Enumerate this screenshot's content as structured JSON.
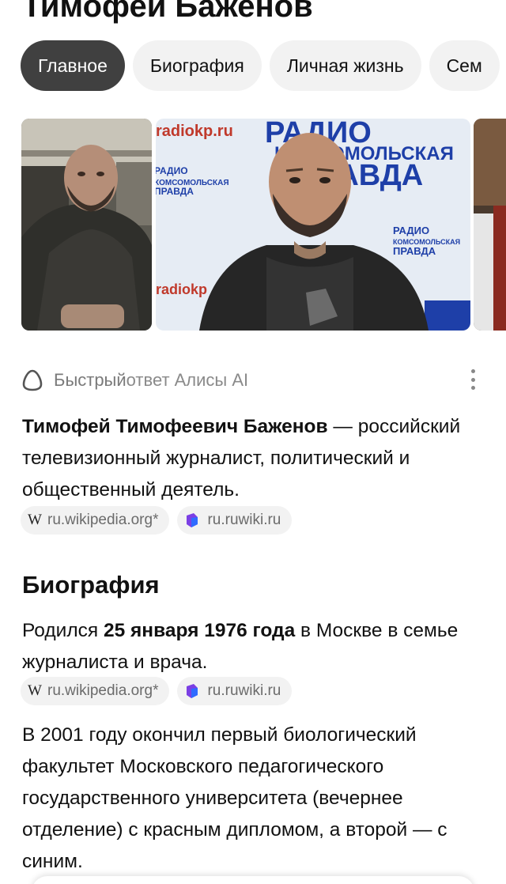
{
  "page_title": "Тимофей Баженов",
  "tabs": [
    {
      "label": "Главное",
      "active": true
    },
    {
      "label": "Биография",
      "active": false
    },
    {
      "label": "Личная жизнь",
      "active": false
    },
    {
      "label": "Сем",
      "active": false
    }
  ],
  "photos": {
    "photo2_texts": [
      "radiokp.ru",
      "РАДИО",
      "КОМСОМОЛЬСКАЯ",
      "ПРАВДА",
      "radiokp"
    ]
  },
  "alice": {
    "label_prefix": "Быстрый ",
    "label_suffix": "ответ Алисы AI"
  },
  "intro": {
    "bold": "Тимофей Тимофеевич Баженов",
    "rest": " — российский телевизионный журналист, политический и общественный деятель."
  },
  "sources_1": [
    {
      "icon": "W",
      "label": "ru.wikipedia.org*"
    },
    {
      "icon": "ruwiki",
      "label": "ru.ruwiki.ru"
    }
  ],
  "biography": {
    "heading": "Биография",
    "p1_before": "Родился ",
    "p1_bold": "25 января 1976 года",
    "p1_after": " в Москве в семье журналиста и врача.",
    "p2": "В 2001 году окончил первый биологический факультет Московского педагогического государственного университета (вечернее отделение) с красным дипломом, а второй — с синим."
  },
  "sources_2": [
    {
      "icon": "W",
      "label": "ru.wikipedia.org*"
    },
    {
      "icon": "ruwiki",
      "label": "ru.ruwiki.ru"
    }
  ],
  "colors": {
    "active_tab": "#404040",
    "chip_bg": "#f2f2f2",
    "ruwiki_purple": "#7b3fe4",
    "ruwiki_blue": "#2f6bff",
    "radio_blue": "#1e3fa8"
  }
}
